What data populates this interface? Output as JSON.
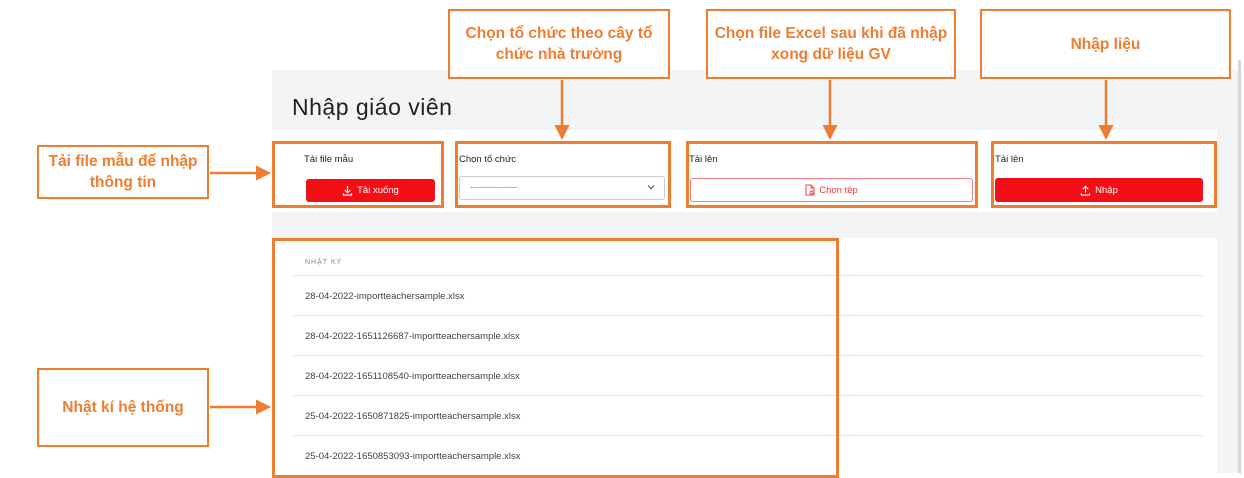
{
  "page": {
    "title": "Nhập giáo viên"
  },
  "download": {
    "label": "Tải file mẫu",
    "button": "Tải xuống"
  },
  "org": {
    "label": "Chọn tổ chức",
    "placeholder": "----------------"
  },
  "upload": {
    "label": "Tải lên",
    "button": "Chọn tệp"
  },
  "import": {
    "label": "Tải lên",
    "button": "Nhập"
  },
  "log": {
    "header": "NHẬT KÝ",
    "rows": [
      "28-04-2022-importteachersample.xlsx",
      "28-04-2022-1651126687-importteachersample.xlsx",
      "28-04-2022-1651108540-importteachersample.xlsx",
      "25-04-2022-1650871825-importteachersample.xlsx",
      "25-04-2022-1650853093-importteachersample.xlsx"
    ]
  },
  "annotations": {
    "download": "Tải file mẫu để nhập thông tin",
    "org": "Chọn tổ chức theo cây tổ chức nhà trường",
    "upload": "Chọn file Excel sau khi đã nhập xong dữ liệu GV",
    "import": "Nhập liệu",
    "log": "Nhật kí hệ thống"
  },
  "colors": {
    "accent": "#f40e16",
    "annotation": "#ed7d31"
  }
}
